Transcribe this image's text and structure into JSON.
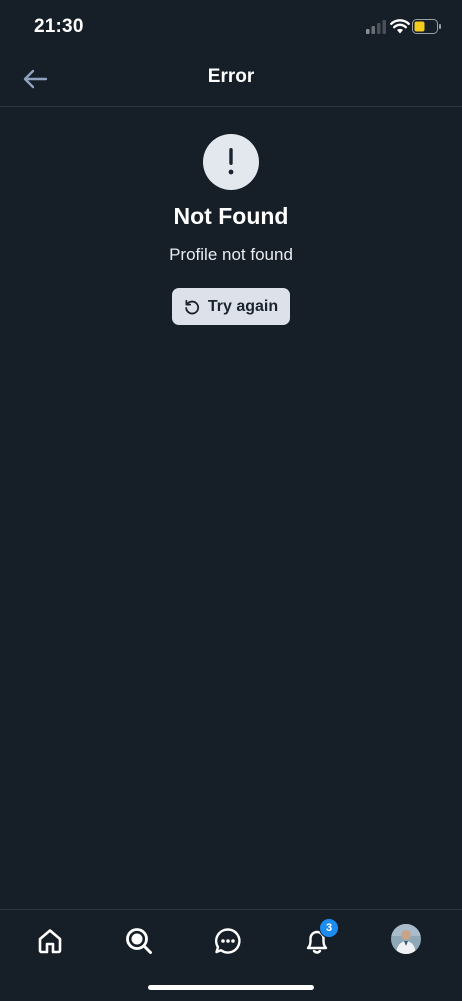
{
  "status_bar": {
    "time": "21:30"
  },
  "header": {
    "title": "Error"
  },
  "error": {
    "title": "Not Found",
    "message": "Profile not found",
    "retry_label": "Try again"
  },
  "tab_bar": {
    "tabs": [
      "home",
      "search",
      "chat",
      "notifications",
      "profile"
    ],
    "notification_badge": "3"
  },
  "colors": {
    "background": "#161e27",
    "divider": "#2a3441",
    "button_bg": "#dde2ea",
    "badge": "#1d8cf0",
    "battery_fill": "#f2cd1b"
  }
}
